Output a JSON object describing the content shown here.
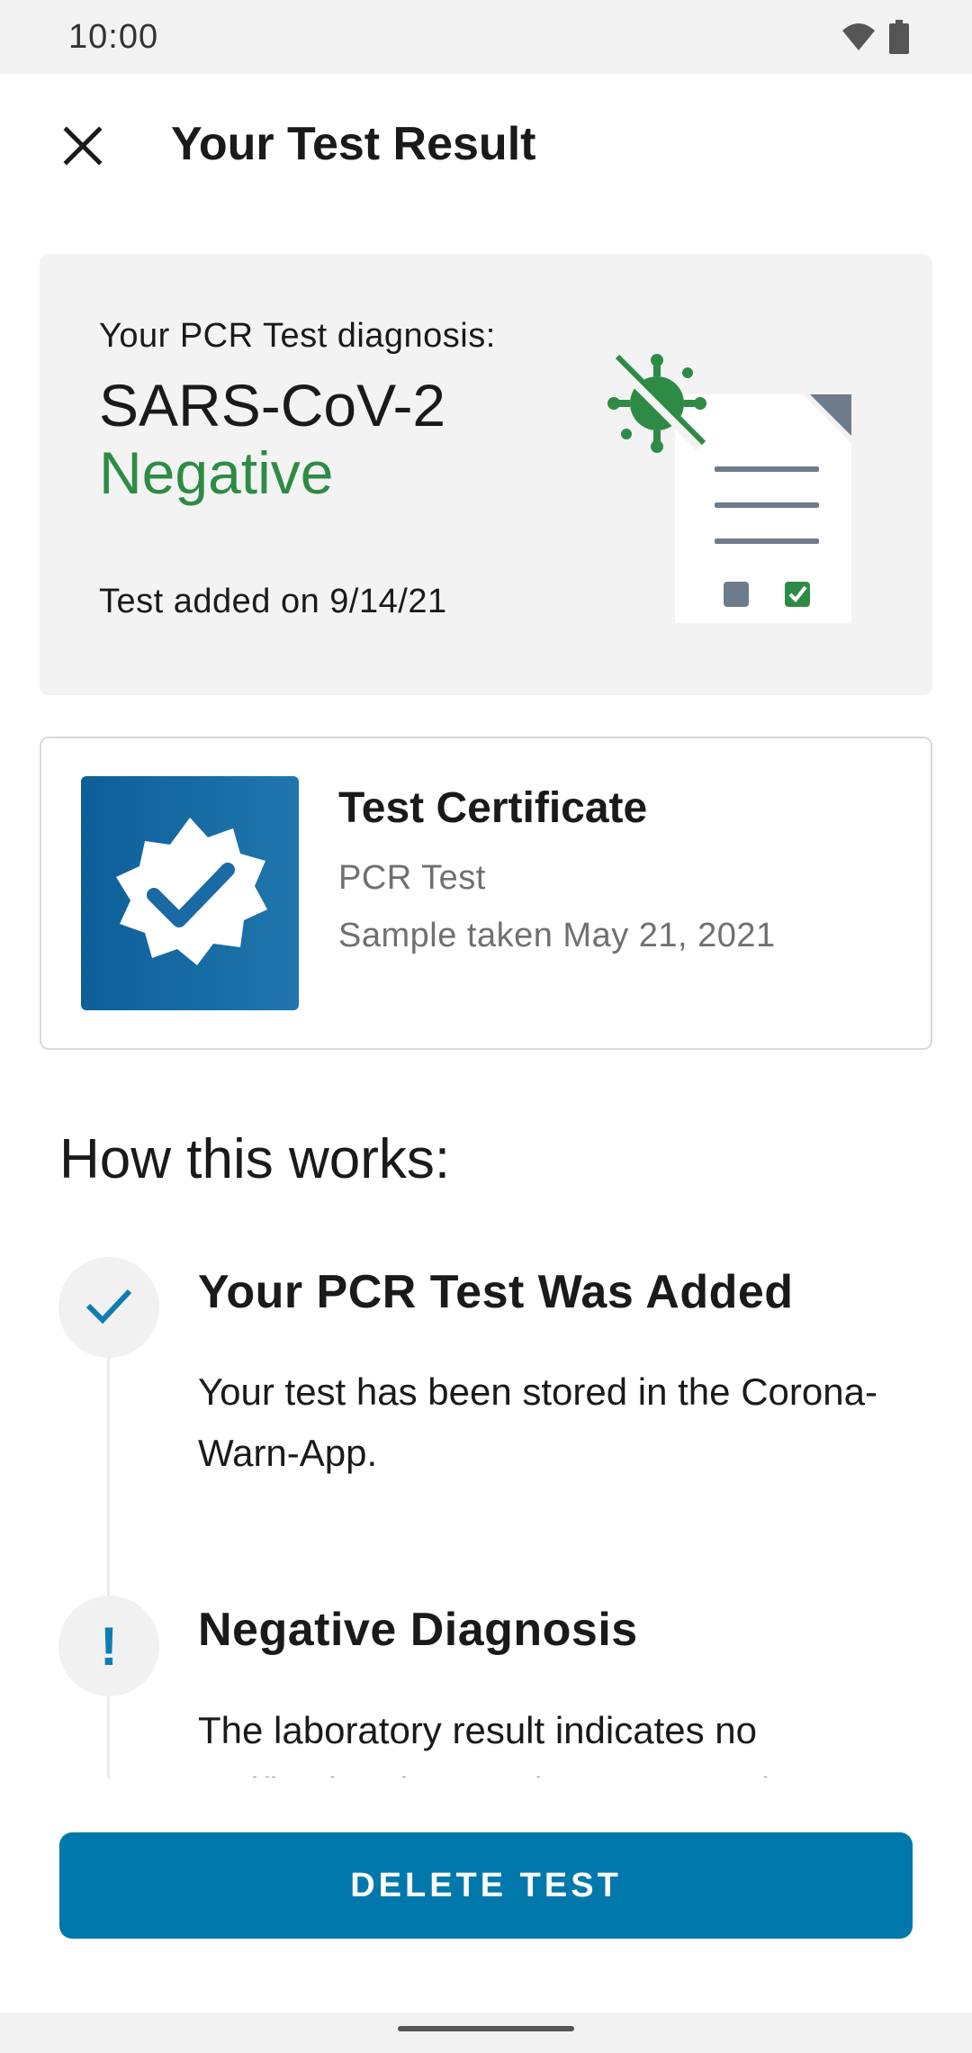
{
  "status_bar": {
    "time": "10:00",
    "icons": [
      "wifi-icon",
      "battery-icon"
    ]
  },
  "app_bar": {
    "title": "Your Test Result",
    "close_icon": "close-icon"
  },
  "result": {
    "label": "Your PCR Test diagnosis:",
    "virus": "SARS-CoV-2",
    "status": "Negative",
    "added": "Test added on 9/14/21",
    "status_color": "#2e8b45"
  },
  "certificate": {
    "title": "Test Certificate",
    "subtitle": "PCR Test",
    "sample": "Sample taken May 21, 2021",
    "icon": "certificate-badge-icon"
  },
  "how": {
    "title": "How this works:",
    "steps": [
      {
        "title": "Your PCR Test Was Added",
        "body": "Your test has been stored in the Corona-Warn-App.",
        "icon": "check-icon"
      },
      {
        "title": "Negative Diagnosis",
        "body": "The laboratory result indicates no verification that you have coronavirus",
        "icon": "exclamation-icon",
        "icon_glyph": "!"
      }
    ]
  },
  "actions": {
    "delete_label": "DELETE TEST"
  },
  "colors": {
    "accent": "#0078ab",
    "positive": "#2e8b45",
    "cert_blue": "#1a6aa5"
  }
}
